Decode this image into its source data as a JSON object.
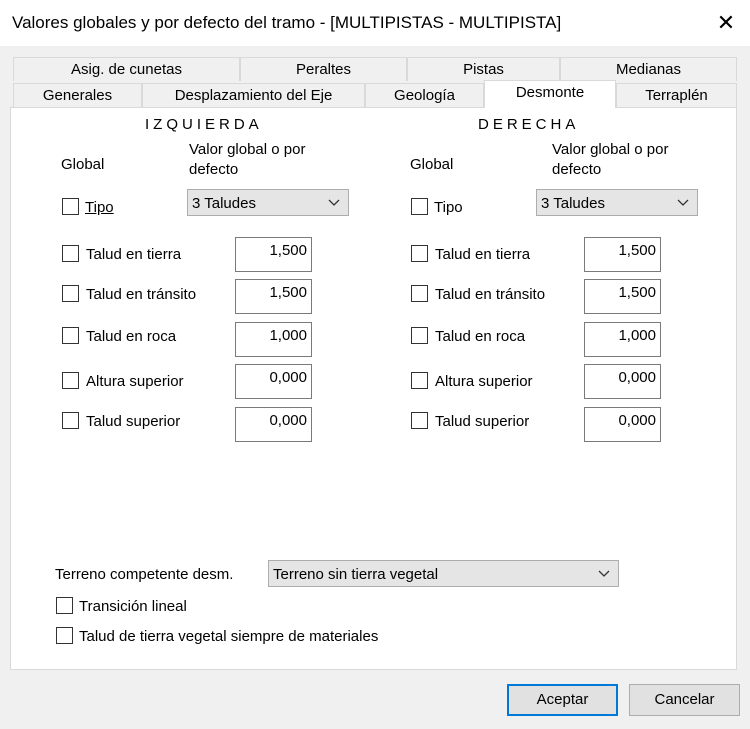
{
  "window": {
    "title": "Valores globales y por defecto del tramo  - [MULTIPISTAS - MULTIPISTA]",
    "close_glyph": "✕"
  },
  "tabs_row1": [
    "Asig. de cunetas",
    "Peraltes",
    "Pistas",
    "Medianas"
  ],
  "tabs_row2": [
    "Generales",
    "Desplazamiento del Eje",
    "Geología",
    "Desmonte",
    "Terraplén"
  ],
  "left": {
    "header": "IZQUIERDA",
    "global_label": "Global",
    "value_label_1": "Valor global o por",
    "value_label_2": "defecto",
    "tipo_label": "Tipo",
    "tipo_value": "3 Taludes",
    "rows": [
      {
        "label": "Talud en tierra",
        "value": "1,500"
      },
      {
        "label": "Talud en tránsito",
        "value": "1,500"
      },
      {
        "label": "Talud en roca",
        "value": "1,000"
      },
      {
        "label": "Altura superior",
        "value": "0,000"
      },
      {
        "label": "Talud superior",
        "value": "0,000"
      }
    ]
  },
  "right": {
    "header": "DERECHA",
    "global_label": "Global",
    "value_label_1": "Valor global o por",
    "value_label_2": "defecto",
    "tipo_label": "Tipo",
    "tipo_value": "3 Taludes",
    "rows": [
      {
        "label": "Talud en tierra",
        "value": "1,500"
      },
      {
        "label": "Talud en tránsito",
        "value": "1,500"
      },
      {
        "label": "Talud en roca",
        "value": "1,000"
      },
      {
        "label": "Altura superior",
        "value": "0,000"
      },
      {
        "label": "Talud superior",
        "value": "0,000"
      }
    ]
  },
  "terreno": {
    "label": "Terreno competente desm.",
    "value": "Terreno sin tierra vegetal"
  },
  "transicion_label": "Transición lineal",
  "talud_vegetal_label": "Talud de tierra vegetal siempre de materiales",
  "buttons": {
    "accept": "Aceptar",
    "cancel": "Cancelar"
  }
}
